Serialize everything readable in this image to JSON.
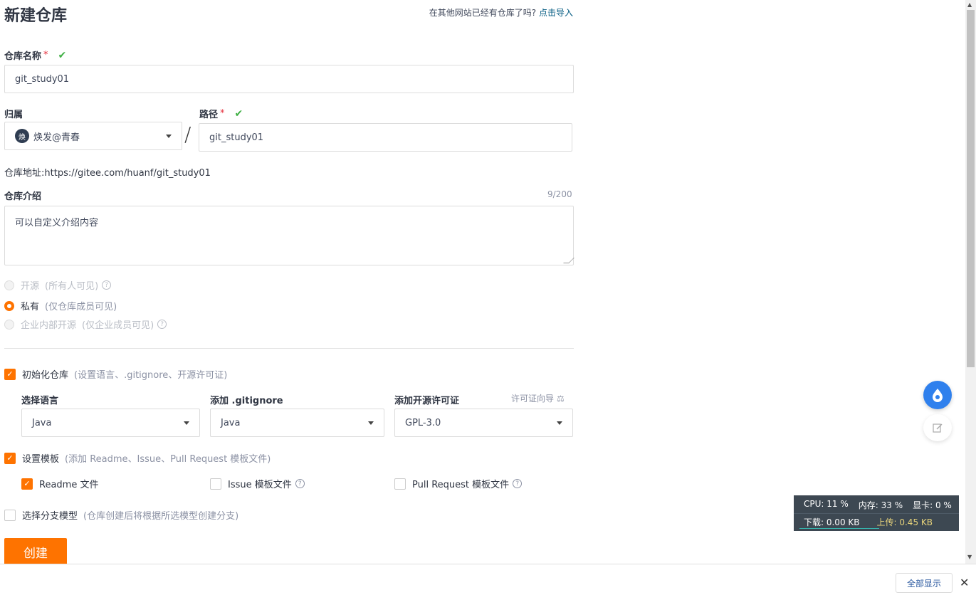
{
  "page": {
    "title": "新建仓库",
    "import_hint": "在其他网站已经有仓库了吗?",
    "import_link": "点击导入"
  },
  "repo_name": {
    "label": "仓库名称",
    "required_mark": "*",
    "value": "git_study01"
  },
  "owner": {
    "label": "归属",
    "avatar_text": "焕",
    "value": "焕发@青春",
    "separator": "/"
  },
  "path": {
    "label": "路径",
    "required_mark": "*",
    "value": "git_study01"
  },
  "repo_address": {
    "label": "仓库地址:",
    "value": "https://gitee.com/huanf/git_study01"
  },
  "intro": {
    "label": "仓库介绍",
    "counter": "9/200",
    "value": "可以自定义介绍内容"
  },
  "visibility": {
    "options": [
      {
        "label": "开源",
        "hint": "(所有人可见)",
        "state": "disabled"
      },
      {
        "label": "私有",
        "hint": "(仅仓库成员可见)",
        "state": "selected"
      },
      {
        "label": "企业内部开源",
        "hint": "(仅企业成员可见)",
        "state": "disabled"
      }
    ]
  },
  "init_repo": {
    "label": "初始化仓库",
    "hint": "(设置语言、.gitignore、开源许可证)",
    "checked": true
  },
  "language": {
    "label": "选择语言",
    "value": "Java"
  },
  "gitignore": {
    "label": "添加 .gitignore",
    "value": "Java"
  },
  "license": {
    "label": "添加开源许可证",
    "guide": "许可证向导",
    "value": "GPL-3.0"
  },
  "template": {
    "label": "设置模板",
    "hint": "(添加 Readme、Issue、Pull Request 模板文件)",
    "checked": true
  },
  "template_files": [
    {
      "label": "Readme 文件",
      "checked": true
    },
    {
      "label": "Issue 模板文件",
      "checked": false
    },
    {
      "label": "Pull Request 模板文件",
      "checked": false
    }
  ],
  "branch_model": {
    "label": "选择分支模型",
    "hint": "(仓库创建后将根据所选模型创建分支)",
    "checked": false
  },
  "create_button": "创建",
  "monitor": {
    "cpu": "CPU: 11 %",
    "mem": "内存: 33 %",
    "gpu": "显卡: 0 %",
    "download": "下载: 0.00 KB",
    "upload": "上传: 0.45 KB"
  },
  "bottom_bar": {
    "show_all": "全部显示",
    "close": "✕"
  },
  "colors": {
    "accent": "#fe7300",
    "link": "#005980",
    "check": "#40b045",
    "required": "#e52c3a"
  }
}
